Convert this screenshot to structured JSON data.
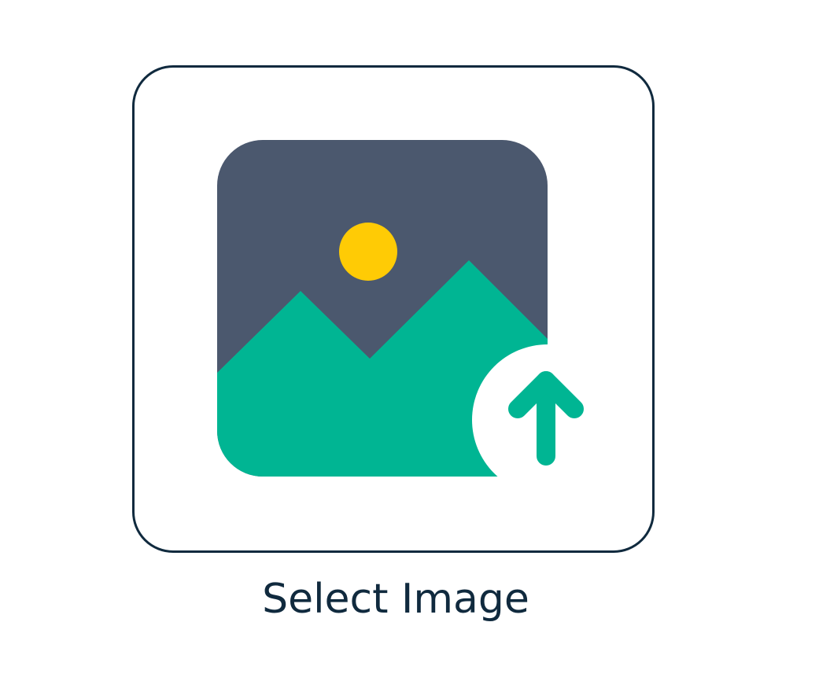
{
  "upload": {
    "label": "Select Image",
    "icon": "image-upload-icon"
  },
  "colors": {
    "border": "#102a3e",
    "label": "#102a3e",
    "frame": "#4b586e",
    "sun": "#ffcb05",
    "mountain": "#00b593",
    "badge": "#ffffff"
  }
}
